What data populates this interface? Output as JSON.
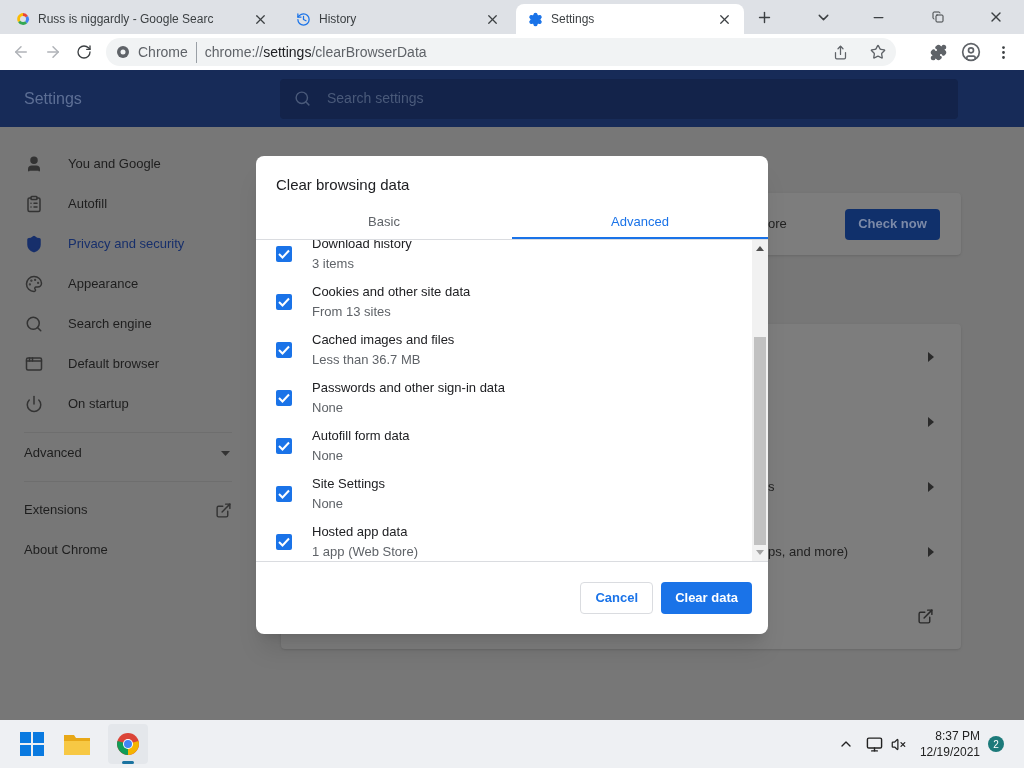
{
  "browser_tabs": [
    {
      "title": "Russ is niggardly - Google Searc",
      "selected": false
    },
    {
      "title": "History",
      "selected": false
    },
    {
      "title": "Settings",
      "selected": true
    }
  ],
  "address_bar": {
    "site_label": "Chrome",
    "url_prefix": "chrome://",
    "url_host": "settings",
    "url_path": "/clearBrowserData"
  },
  "settings_header": {
    "title": "Settings",
    "search_placeholder": "Search settings"
  },
  "sidebar": {
    "items": [
      {
        "label": "You and Google",
        "selected": false
      },
      {
        "label": "Autofill",
        "selected": false
      },
      {
        "label": "Privacy and security",
        "selected": true
      },
      {
        "label": "Appearance",
        "selected": false
      },
      {
        "label": "Search engine",
        "selected": false
      },
      {
        "label": "Default browser",
        "selected": false
      },
      {
        "label": "On startup",
        "selected": false
      }
    ],
    "advanced": {
      "label": "Advanced",
      "expanded": false
    },
    "links": [
      {
        "label": "Extensions",
        "external": true
      },
      {
        "label": "About Chrome",
        "external": false
      }
    ]
  },
  "main": {
    "safety_card": {
      "text": "ore",
      "button": "Check now"
    },
    "privacy_rows": [
      {
        "text": "s"
      },
      {
        "text": "ps, and more)"
      }
    ]
  },
  "dialog": {
    "title": "Clear browsing data",
    "tabs": [
      {
        "label": "Basic",
        "selected": false
      },
      {
        "label": "Advanced",
        "selected": true
      }
    ],
    "items": [
      {
        "label": "Download history",
        "detail": "3 items",
        "checked": true
      },
      {
        "label": "Cookies and other site data",
        "detail": "From 13 sites",
        "checked": true
      },
      {
        "label": "Cached images and files",
        "detail": "Less than 36.7 MB",
        "checked": true
      },
      {
        "label": "Passwords and other sign-in data",
        "detail": "None",
        "checked": true
      },
      {
        "label": "Autofill form data",
        "detail": "None",
        "checked": true
      },
      {
        "label": "Site Settings",
        "detail": "None",
        "checked": true
      },
      {
        "label": "Hosted app data",
        "detail": "1 app (Web Store)",
        "checked": true
      }
    ],
    "buttons": [
      {
        "label": "Cancel",
        "kind": "secondary"
      },
      {
        "label": "Clear data",
        "kind": "primary"
      }
    ]
  },
  "taskbar": {
    "time": "8:37 PM",
    "date": "12/19/2021",
    "notifications": "2"
  }
}
